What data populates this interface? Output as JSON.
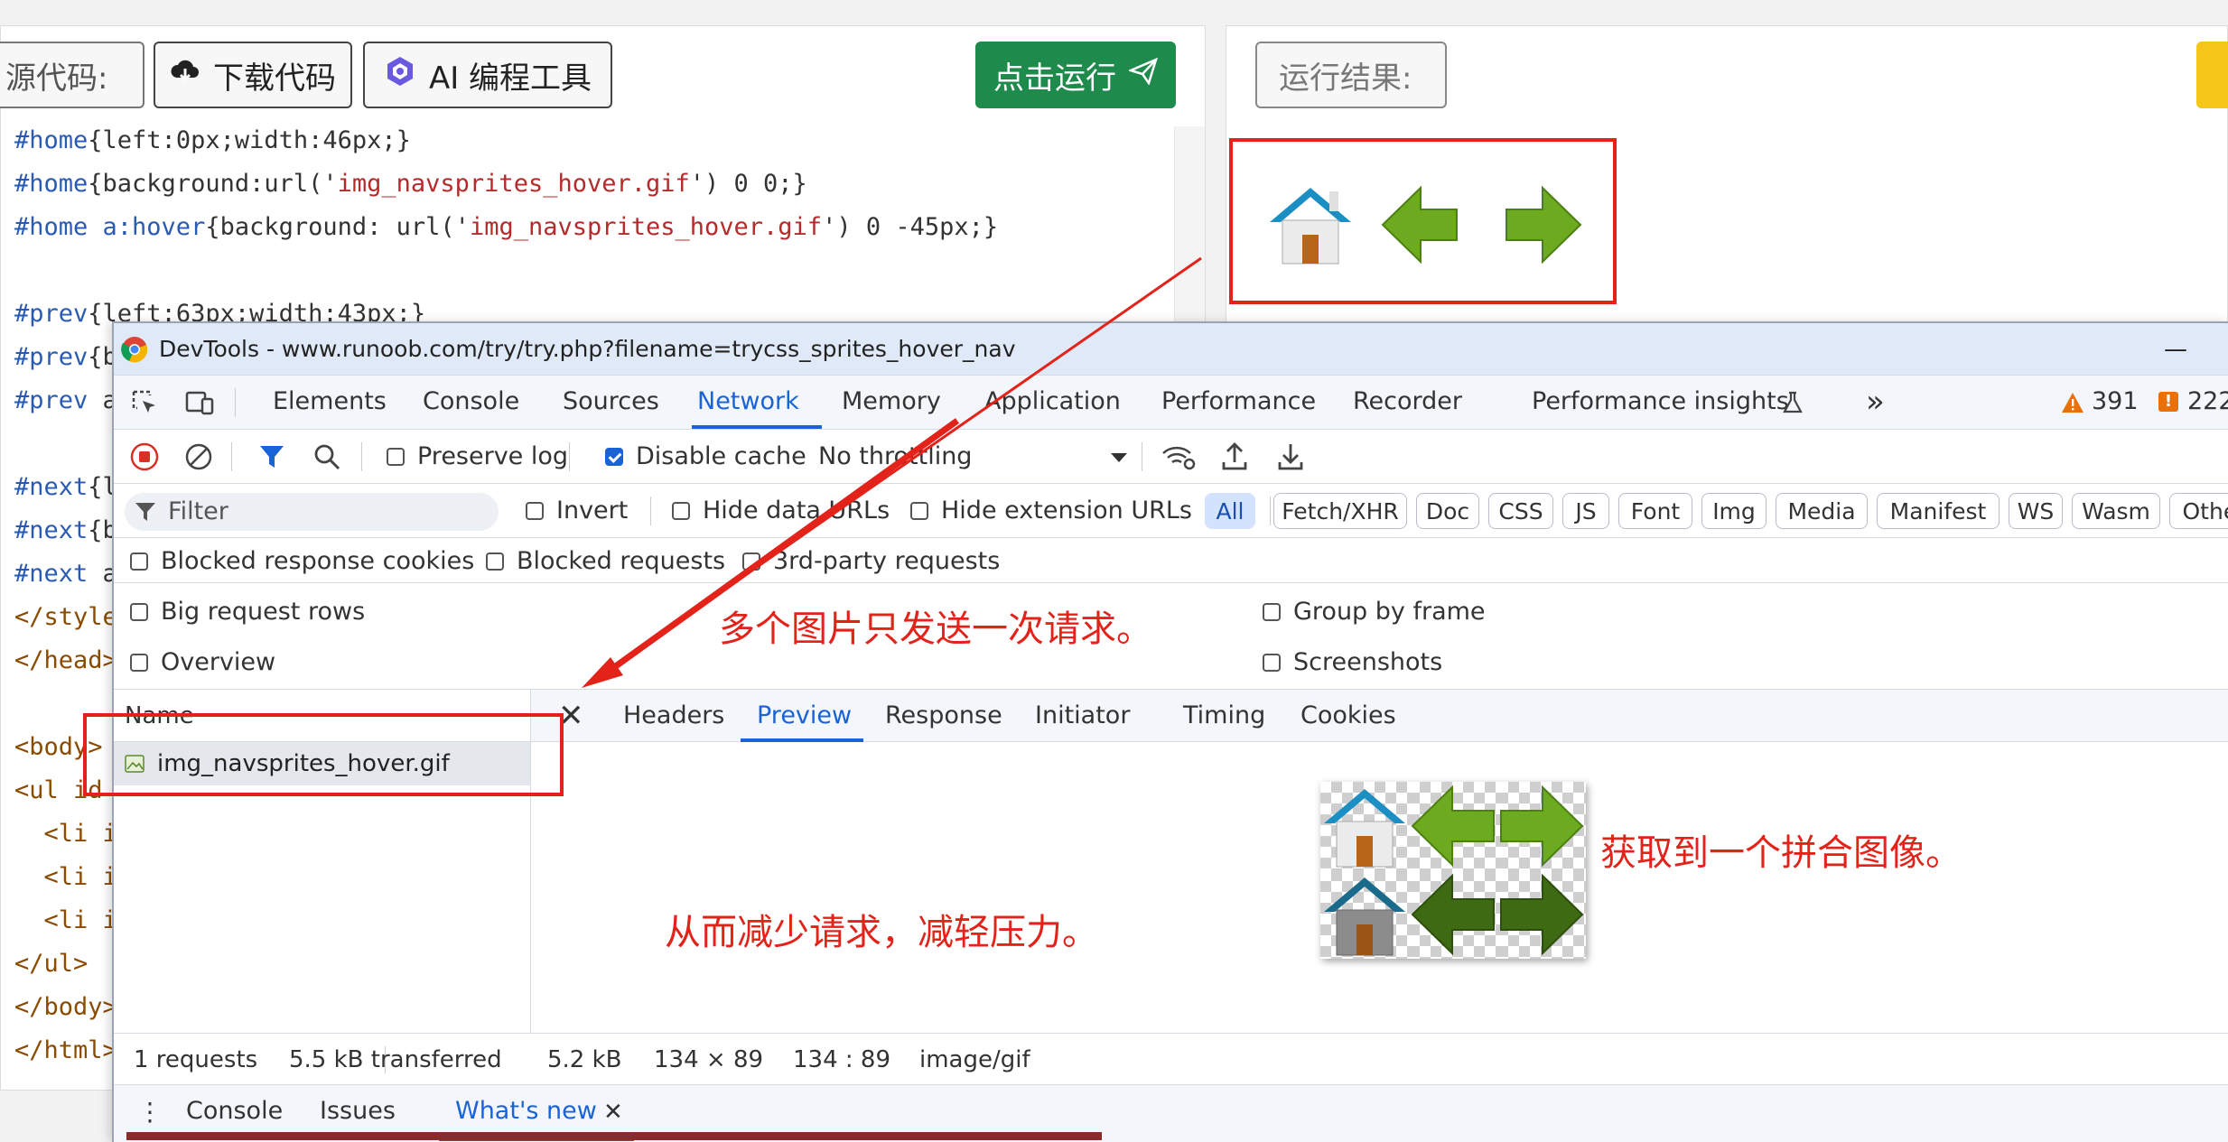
{
  "toolbar": {
    "source_label": "源代码:",
    "download_label": "下载代码",
    "ai_label": "AI 编程工具",
    "run_label": "点击运行",
    "result_label": "运行结果:"
  },
  "code_lines": [
    {
      "sel": "#home",
      "body": "{left:0px;width:46px;}"
    },
    {
      "sel": "#home",
      "body": "{background:url('",
      "str": "img_navsprites_hover.gif",
      "tail": "') 0 0;}"
    },
    {
      "sel": "#home a:hover",
      "body": "{background: url('",
      "str": "img_navsprites_hover.gif",
      "tail": "') 0 -45px;}"
    },
    {
      "sel": "",
      "body": ""
    },
    {
      "sel": "#prev",
      "body": "{left:63px;width:43px;}"
    },
    {
      "sel": "#prev",
      "body": "{b"
    },
    {
      "sel": "#prev",
      "body": " a"
    },
    {
      "sel": "",
      "body": ""
    },
    {
      "sel": "#next",
      "body": "{l"
    },
    {
      "sel": "#next",
      "body": "{b"
    },
    {
      "sel": "#next",
      "body": " a"
    },
    {
      "sel": "",
      "body": "</style"
    },
    {
      "sel": "",
      "body": "</head>"
    },
    {
      "sel": "",
      "body": ""
    },
    {
      "sel": "",
      "body": "<body>"
    },
    {
      "sel": "",
      "body": "<ul id"
    },
    {
      "sel": "",
      "body": "  <li i"
    },
    {
      "sel": "",
      "body": "  <li i"
    },
    {
      "sel": "",
      "body": "  <li i"
    },
    {
      "sel": "",
      "body": "</ul>"
    },
    {
      "sel": "",
      "body": "</body>"
    },
    {
      "sel": "",
      "body": "</html>"
    }
  ],
  "devtools": {
    "title": "DevTools - www.runoob.com/try/try.php?filename=trycss_sprites_hover_nav",
    "minimize": "—",
    "tabs": [
      "Elements",
      "Console",
      "Sources",
      "Network",
      "Memory",
      "Application",
      "Performance",
      "Recorder",
      "Performance insights"
    ],
    "active_tab": "Network",
    "more_tabs": "»",
    "warnings": "391",
    "errors": "222",
    "network_toolbar": {
      "preserve_log": "Preserve log",
      "disable_cache": "Disable cache",
      "throttling": "No throttling"
    },
    "filter_placeholder": "Filter",
    "filter_options": {
      "invert": "Invert",
      "hide_data_urls": "Hide data URLs",
      "hide_extension_urls": "Hide extension URLs"
    },
    "type_filters": [
      "All",
      "Fetch/XHR",
      "Doc",
      "CSS",
      "JS",
      "Font",
      "Img",
      "Media",
      "Manifest",
      "WS",
      "Wasm",
      "Other"
    ],
    "row3": {
      "blocked_cookies": "Blocked response cookies",
      "blocked_requests": "Blocked requests",
      "third_party": "3rd-party requests"
    },
    "settings": {
      "big_rows": "Big request rows",
      "overview": "Overview",
      "group_by_frame": "Group by frame",
      "screenshots": "Screenshots"
    },
    "name_header": "Name",
    "request_name": "img_navsprites_hover.gif",
    "detail_tabs": [
      "Headers",
      "Preview",
      "Response",
      "Initiator",
      "Timing",
      "Cookies"
    ],
    "active_detail_tab": "Preview",
    "status_left": {
      "requests": "1 requests",
      "transferred": "5.5 kB transferred"
    },
    "status_right": {
      "size": "5.2 kB",
      "dims": "134 × 89",
      "ratio": "134 : 89",
      "mime": "image/gif"
    },
    "drawer_tabs": [
      "Console",
      "Issues",
      "What's new"
    ],
    "active_drawer_tab": "What's new"
  },
  "annotations": {
    "one_request": "多个图片只发送一次请求。",
    "sprite_obtained": "获取到一个拼合图像。",
    "reduce_load": "从而减少请求，减轻压力。"
  },
  "colors": {
    "accent": "#1a63d6",
    "run_button": "#1e8a4c",
    "annotation_red": "#e3231a",
    "warning": "#e8710a"
  }
}
